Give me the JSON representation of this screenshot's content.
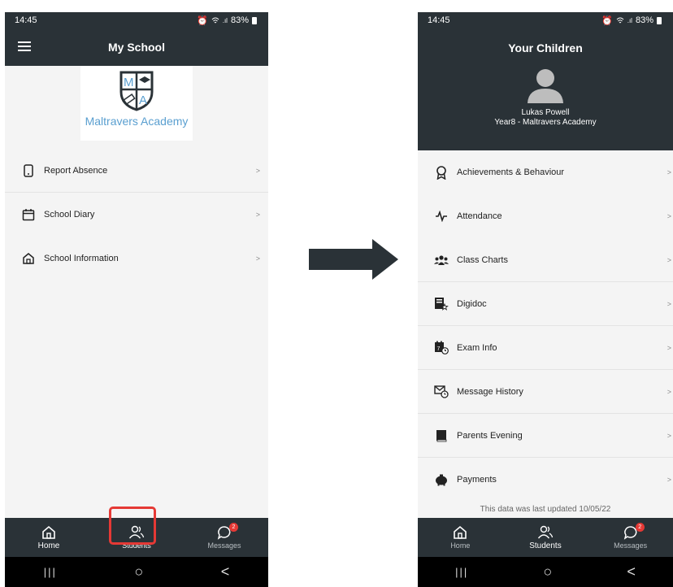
{
  "left_screen": {
    "status": {
      "time": "14:45",
      "battery": "83%"
    },
    "title": "My School",
    "logo_text": "Maltravers Academy",
    "logo_letters": [
      "M",
      "A"
    ],
    "menu": [
      {
        "label": "Report Absence",
        "chevron": ">"
      },
      {
        "label": "School Diary",
        "chevron": ">"
      },
      {
        "label": "School Information",
        "chevron": ">"
      }
    ],
    "nav": [
      {
        "label": "Home"
      },
      {
        "label": "Students"
      },
      {
        "label": "Messages",
        "badge": "2"
      }
    ]
  },
  "right_screen": {
    "status": {
      "time": "14:45",
      "battery": "83%"
    },
    "title": "Your Children",
    "child_name": "Lukas Powell",
    "child_info": "Year8 - Maltravers Academy",
    "menu": [
      {
        "label": "Achievements & Behaviour",
        "chevron": ">"
      },
      {
        "label": "Attendance",
        "chevron": ">"
      },
      {
        "label": "Class Charts",
        "chevron": ">"
      },
      {
        "label": "Digidoc",
        "chevron": ">"
      },
      {
        "label": "Exam Info",
        "chevron": ">"
      },
      {
        "label": "Message History",
        "chevron": ">"
      },
      {
        "label": "Parents Evening",
        "chevron": ">"
      },
      {
        "label": "Payments",
        "chevron": ">"
      }
    ],
    "updated_text": "This data was last updated 10/05/22",
    "nav": [
      {
        "label": "Home"
      },
      {
        "label": "Students"
      },
      {
        "label": "Messages",
        "badge": "2"
      }
    ]
  },
  "system_nav": {
    "recent": "|||",
    "home": "○",
    "back": "<"
  },
  "colors": {
    "bar": "#2a3237",
    "highlight": "#e53935",
    "logo_blue": "#5a9fd0",
    "arrow": "#2a3237"
  }
}
